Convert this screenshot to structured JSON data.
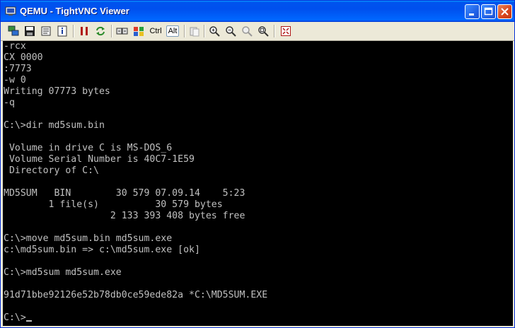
{
  "window": {
    "title": "QEMU - TightVNC Viewer",
    "accent": "#0054e3",
    "icon": "vnc-app-icon"
  },
  "controls": {
    "minimize_icon": "minimize-icon",
    "maximize_icon": "maximize-icon",
    "close_icon": "close-icon"
  },
  "toolbar": {
    "ctrl_label": "Ctrl",
    "alt_label": "Alt",
    "icons": [
      "new-connection-icon",
      "save-icon",
      "options-icon",
      "connection-info-icon",
      "pause-icon",
      "refresh-icon",
      "send-ctrl-alt-del-icon",
      "send-ctrl-esc-icon",
      "ctrl-key",
      "alt-key",
      "clipboard-icon",
      "zoom-in-icon",
      "zoom-out-icon",
      "zoom-100-icon",
      "zoom-fit-icon",
      "fullscreen-icon"
    ]
  },
  "terminal": {
    "bg": "#000000",
    "fg": "#c0c0c0",
    "lines": [
      "-rcx",
      "CX 0000",
      ":7773",
      "-w 0",
      "Writing 07773 bytes",
      "-q",
      "",
      "C:\\>dir md5sum.bin",
      "",
      " Volume in drive C is MS-DOS_6",
      " Volume Serial Number is 40C7-1E59",
      " Directory of C:\\",
      "",
      "MD5SUM   BIN        30 579 07.09.14    5:23",
      "        1 file(s)          30 579 bytes",
      "                   2 133 393 408 bytes free",
      "",
      "C:\\>move md5sum.bin md5sum.exe",
      "c:\\md5sum.bin => c:\\md5sum.exe [ok]",
      "",
      "C:\\>md5sum md5sum.exe",
      "",
      "91d71bbe92126e52b78db0ce59ede82a *C:\\MD5SUM.EXE",
      "",
      "C:\\>"
    ]
  }
}
